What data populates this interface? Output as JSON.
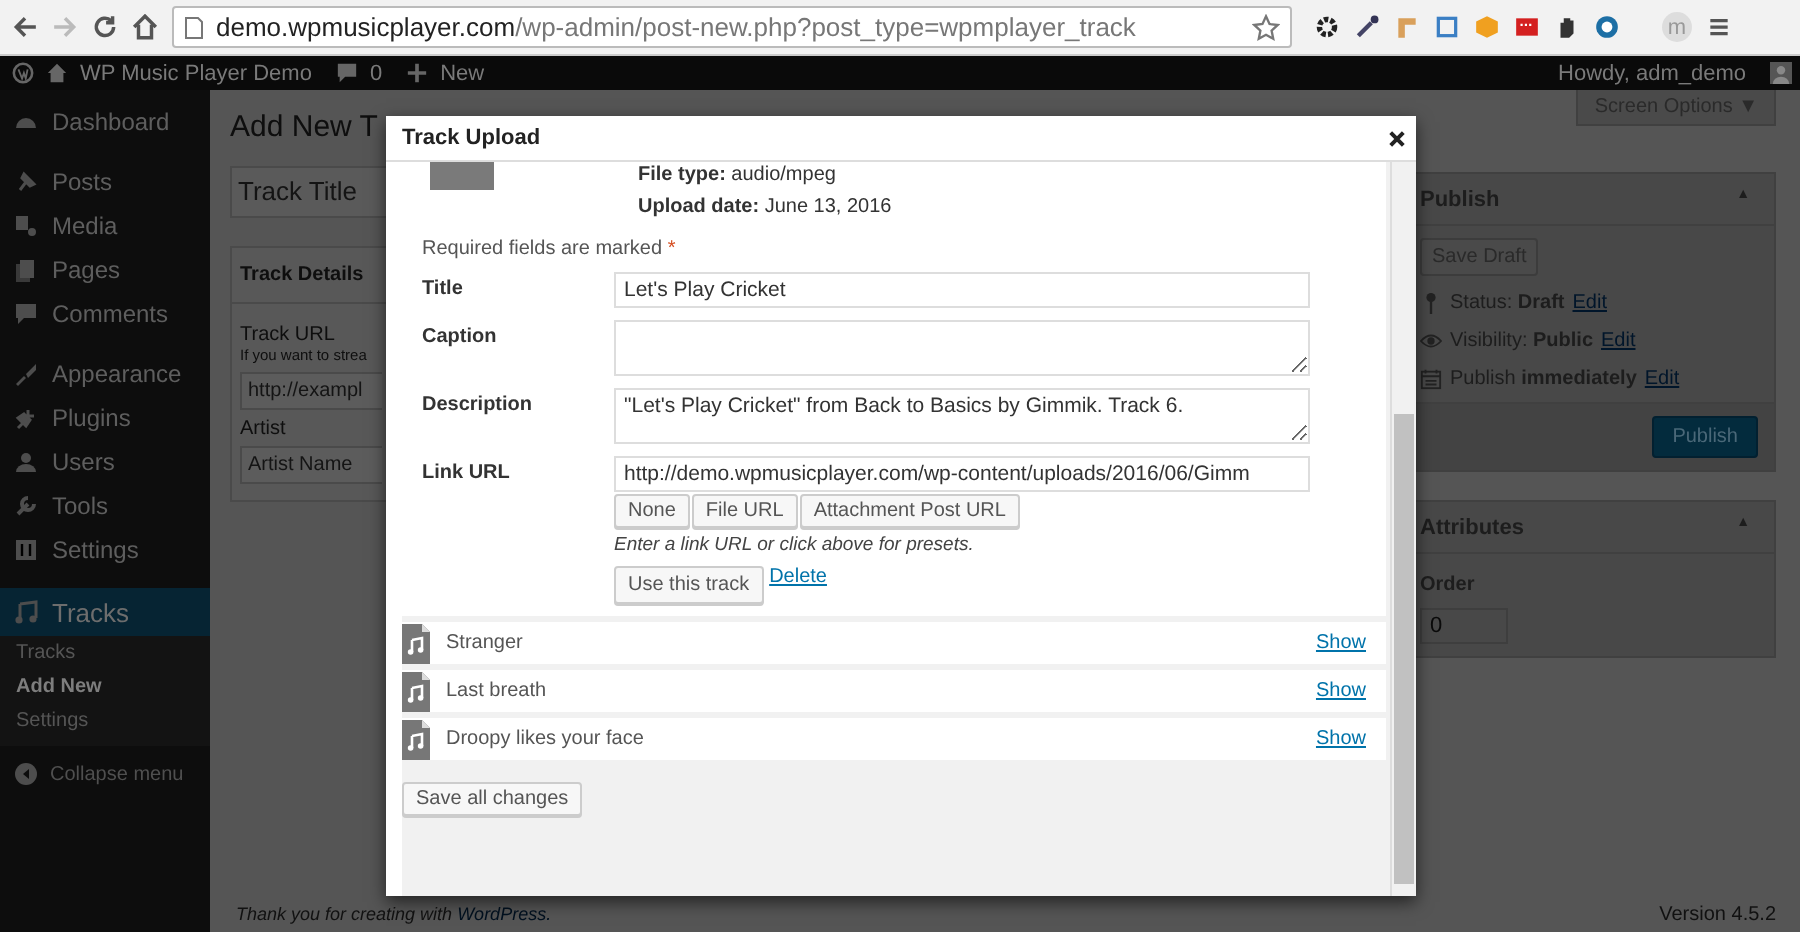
{
  "browser": {
    "url_host": "demo.wpmusicplayer.com",
    "url_path": "/wp-admin/post-new.php?post_type=wpmplayer_track",
    "profile_initial": "m"
  },
  "admin_bar": {
    "site_name": "WP Music Player Demo",
    "comments_count": "0",
    "new_label": "New",
    "greeting": "Howdy, adm_demo"
  },
  "sidebar": {
    "groups": [
      {
        "items": [
          {
            "label": "Dashboard",
            "kind": "dashboard",
            "selected": false
          }
        ]
      },
      {
        "items": [
          {
            "label": "Posts",
            "kind": "posts",
            "selected": false
          },
          {
            "label": "Media",
            "kind": "media",
            "selected": false
          },
          {
            "label": "Pages",
            "kind": "pages",
            "selected": false
          },
          {
            "label": "Comments",
            "kind": "comments",
            "selected": false
          }
        ]
      },
      {
        "items": [
          {
            "label": "Appearance",
            "kind": "appearance",
            "selected": false
          },
          {
            "label": "Plugins",
            "kind": "plugins",
            "selected": false
          },
          {
            "label": "Users",
            "kind": "users",
            "selected": false
          },
          {
            "label": "Tools",
            "kind": "tools",
            "selected": false
          },
          {
            "label": "Settings",
            "kind": "settings",
            "selected": false
          }
        ]
      },
      {
        "items": [
          {
            "label": "Tracks",
            "kind": "tracks",
            "selected": true
          }
        ]
      }
    ],
    "submenu": [
      {
        "label": "Tracks",
        "selected": false
      },
      {
        "label": "Add New",
        "selected": true
      },
      {
        "label": "Settings",
        "selected": false
      }
    ],
    "collapse_label": "Collapse menu"
  },
  "page": {
    "heading": "Add New T",
    "title_placeholder": "Track Title",
    "details_box": {
      "title": "Track Details",
      "fields": [
        {
          "label": "Track URL",
          "hint": "If you want to strea",
          "placeholder": "http://exampl"
        },
        {
          "label": "Artist",
          "placeholder": "Artist Name"
        }
      ]
    }
  },
  "modal": {
    "title": "Track Upload",
    "file_type_label": "File type:",
    "file_type": "audio/mpeg",
    "upload_date_label": "Upload date:",
    "upload_date": "June 13, 2016",
    "required_note": "Required fields are marked",
    "required_mark": "*",
    "fields": [
      {
        "label": "Title",
        "kind": "input",
        "value": "Let's Play Cricket"
      },
      {
        "label": "Caption",
        "kind": "textarea"
      },
      {
        "label": "Description",
        "kind": "textarea",
        "value": "\"Let's Play Cricket\" from Back to Basics by Gimmik. Track 6."
      },
      {
        "label": "Link URL",
        "kind": "input",
        "value": "http://demo.wpmusicplayer.com/wp-content/uploads/2016/06/Gimm"
      }
    ],
    "link_buttons": [
      "None",
      "File URL",
      "Attachment Post URL"
    ],
    "link_hint": "Enter a link URL or click above for presets.",
    "use_button": "Use this track",
    "delete_link": "Delete",
    "tracks": [
      {
        "name": "Stranger",
        "action": "Show"
      },
      {
        "name": "Last breath",
        "action": "Show"
      },
      {
        "name": "Droopy likes your face",
        "action": "Show"
      }
    ],
    "save_button": "Save all changes"
  },
  "right": {
    "screen_options": "Screen Options",
    "screen_options_caret": "▼",
    "publish_box": {
      "title": "Publish",
      "toggle": "▲",
      "save_draft": "Save Draft",
      "rows": [
        {
          "kind": "status",
          "label": "Status:",
          "value": "Draft",
          "action": "Edit"
        },
        {
          "kind": "visibility",
          "label": "Visibility:",
          "value": "Public",
          "action": "Edit"
        },
        {
          "kind": "schedule",
          "label": "Publish",
          "value": "immediately",
          "action": "Edit"
        }
      ],
      "publish_button": "Publish"
    },
    "attributes_box": {
      "title": "Attributes",
      "toggle": "▲",
      "order_label": "Order",
      "order_value": "0"
    }
  },
  "footer": {
    "thanks": "Thank you for creating with",
    "thanks_link": "WordPress.",
    "version": "Version 4.5.2"
  }
}
